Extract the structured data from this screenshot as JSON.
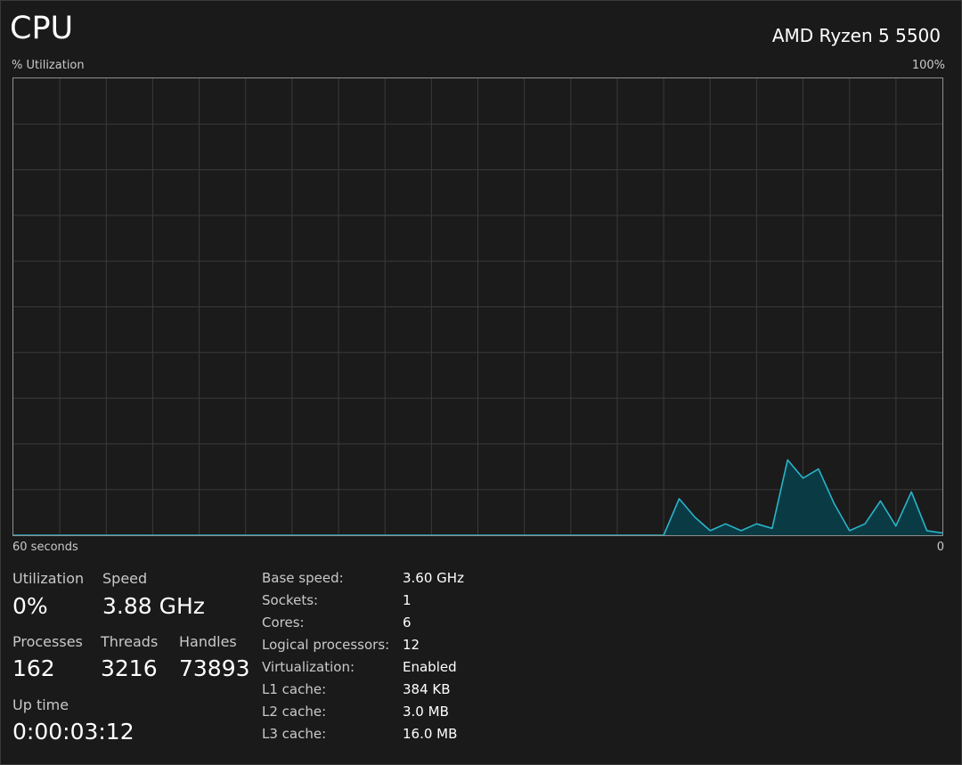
{
  "header": {
    "title": "CPU",
    "processor_name": "AMD Ryzen 5 5500"
  },
  "graph": {
    "y_label": "% Utilization",
    "y_max_label": "100%",
    "x_left_label": "60 seconds",
    "x_right_label": "0",
    "line_color": "#2ab3c9",
    "fill_color": "#0a3b44",
    "grid_color": "#3a3a3a"
  },
  "chart_data": {
    "type": "area",
    "x": [
      0,
      1,
      2,
      3,
      4,
      5,
      6,
      7,
      8,
      9,
      10,
      11,
      12,
      13,
      14,
      15,
      16,
      17,
      18,
      19,
      20,
      21,
      22,
      23,
      24,
      25,
      26,
      27,
      28,
      29,
      30,
      31,
      32,
      33,
      34,
      35,
      36,
      37,
      38,
      39,
      40,
      41,
      42,
      43,
      44,
      45,
      46,
      47,
      48,
      49,
      50,
      51,
      52,
      53,
      54,
      55,
      56,
      57,
      58,
      59,
      60
    ],
    "series": [
      {
        "values": [
          0,
          0,
          0,
          0,
          0,
          0,
          0,
          0,
          0,
          0,
          0,
          0,
          0,
          0,
          0,
          0,
          0,
          0,
          0,
          0,
          0,
          0,
          0,
          0,
          0,
          0,
          0,
          0,
          0,
          0,
          0,
          0,
          0,
          0,
          0,
          0,
          0,
          0,
          0,
          0,
          0,
          0,
          0,
          8,
          4,
          1,
          2.5,
          1,
          2.5,
          1.5,
          16.5,
          12.5,
          14.5,
          7,
          1,
          2.5,
          7.5,
          2,
          9.5,
          1,
          0.5
        ]
      }
    ],
    "xlim": [
      0,
      60
    ],
    "ylim": [
      0,
      100
    ],
    "grid": true,
    "grid_columns": 20,
    "grid_rows": 10
  },
  "stats": {
    "utilization": {
      "label": "Utilization",
      "value": "0%"
    },
    "speed": {
      "label": "Speed",
      "value": "3.88 GHz"
    },
    "processes": {
      "label": "Processes",
      "value": "162"
    },
    "threads": {
      "label": "Threads",
      "value": "3216"
    },
    "handles": {
      "label": "Handles",
      "value": "73893"
    },
    "uptime": {
      "label": "Up time",
      "value": "0:00:03:12"
    }
  },
  "specs": [
    {
      "label": "Base speed:",
      "value": "3.60 GHz"
    },
    {
      "label": "Sockets:",
      "value": "1"
    },
    {
      "label": "Cores:",
      "value": "6"
    },
    {
      "label": "Logical processors:",
      "value": "12"
    },
    {
      "label": "Virtualization:",
      "value": "Enabled"
    },
    {
      "label": "L1 cache:",
      "value": "384 KB"
    },
    {
      "label": "L2 cache:",
      "value": "3.0 MB"
    },
    {
      "label": "L3 cache:",
      "value": "16.0 MB"
    }
  ]
}
